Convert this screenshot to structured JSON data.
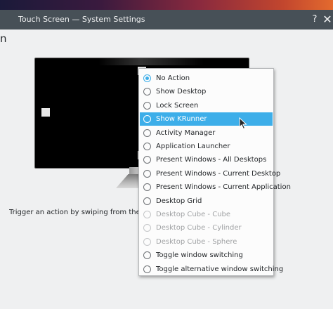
{
  "window": {
    "title": "Touch Screen — System Settings",
    "help_label": "?",
    "close_label": "✕"
  },
  "page": {
    "heading_fragment": "n",
    "description": "Trigger an action by swiping from the screen edge"
  },
  "menu": {
    "items": [
      {
        "label": "No Action",
        "checked": true,
        "selected": false,
        "enabled": true
      },
      {
        "label": "Show Desktop",
        "checked": false,
        "selected": false,
        "enabled": true
      },
      {
        "label": "Lock Screen",
        "checked": false,
        "selected": false,
        "enabled": true
      },
      {
        "label": "Show KRunner",
        "checked": false,
        "selected": true,
        "enabled": true
      },
      {
        "label": "Activity Manager",
        "checked": false,
        "selected": false,
        "enabled": true
      },
      {
        "label": "Application Launcher",
        "checked": false,
        "selected": false,
        "enabled": true
      },
      {
        "label": "Present Windows - All Desktops",
        "checked": false,
        "selected": false,
        "enabled": true
      },
      {
        "label": "Present Windows - Current Desktop",
        "checked": false,
        "selected": false,
        "enabled": true
      },
      {
        "label": "Present Windows - Current Application",
        "checked": false,
        "selected": false,
        "enabled": true
      },
      {
        "label": "Desktop Grid",
        "checked": false,
        "selected": false,
        "enabled": true
      },
      {
        "label": "Desktop Cube - Cube",
        "checked": false,
        "selected": false,
        "enabled": false
      },
      {
        "label": "Desktop Cube - Cylinder",
        "checked": false,
        "selected": false,
        "enabled": false
      },
      {
        "label": "Desktop Cube - Sphere",
        "checked": false,
        "selected": false,
        "enabled": false
      },
      {
        "label": "Toggle window switching",
        "checked": false,
        "selected": false,
        "enabled": true
      },
      {
        "label": "Toggle alternative window switching",
        "checked": false,
        "selected": false,
        "enabled": true
      }
    ]
  },
  "colors": {
    "accent": "#3daee9",
    "titlebar": "#475057",
    "window_bg": "#eff0f1"
  },
  "icons": [
    "help-icon",
    "close-icon",
    "mouse-cursor-icon"
  ]
}
